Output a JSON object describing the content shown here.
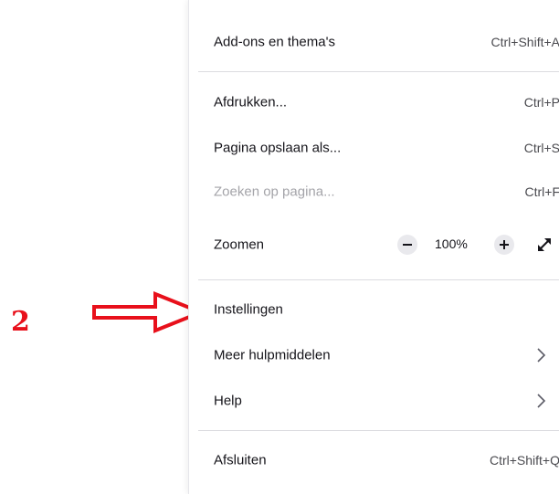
{
  "annotation": {
    "number": "2",
    "color": "#e8101b"
  },
  "menu": {
    "items": [
      {
        "label": "Add-ons en thema's",
        "shortcut": "Ctrl+Shift+A"
      },
      {
        "label": "Afdrukken...",
        "shortcut": "Ctrl+P"
      },
      {
        "label": "Pagina opslaan als...",
        "shortcut": "Ctrl+S"
      },
      {
        "label": "Zoeken op pagina...",
        "shortcut": "Ctrl+F",
        "disabled": true
      },
      {
        "label": "Zoomen"
      },
      {
        "label": "Instellingen"
      },
      {
        "label": "Meer hulpmiddelen",
        "icon": "chevron-right-icon"
      },
      {
        "label": "Help",
        "icon": "chevron-right-icon"
      },
      {
        "label": "Afsluiten",
        "shortcut": "Ctrl+Shift+Q"
      }
    ],
    "zoom": {
      "value": "100%",
      "decrease_icon": "minus-icon",
      "increase_icon": "plus-icon",
      "fullscreen_icon": "fullscreen-expand-icon"
    }
  }
}
